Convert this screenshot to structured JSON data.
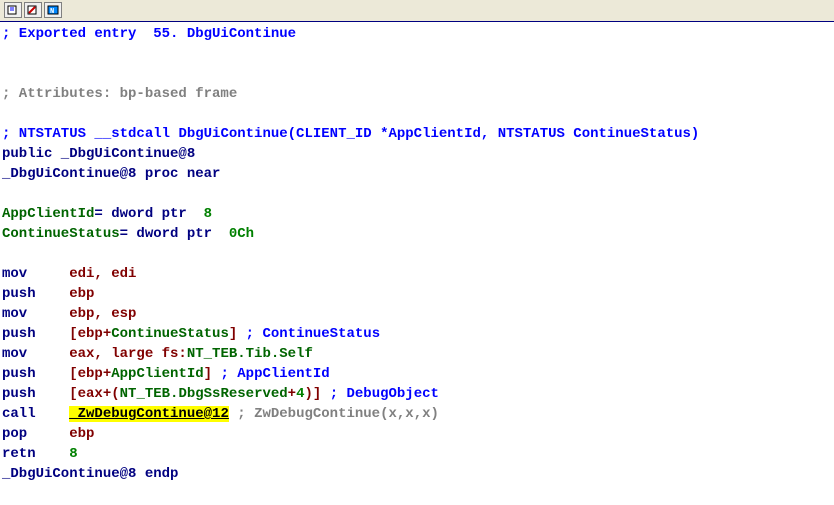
{
  "comment_exported": "; Exported entry  55. DbgUiContinue",
  "comment_attributes": "; Attributes: bp-based frame",
  "comment_signature_prefix": "; NTSTATUS __stdcall ",
  "comment_signature_func": "DbgUiContinue",
  "comment_signature_params": "(CLIENT_ID *AppClientId, NTSTATUS ContinueStatus)",
  "public_decl": "public _DbgUiContinue@8",
  "proc_start_label": "_DbgUiContinue@8",
  "proc_start_suffix": " proc near",
  "local_var1_name": "AppClientId",
  "local_var1_type": "= dword ptr  ",
  "local_var1_offset": "8",
  "local_var2_name": "ContinueStatus",
  "local_var2_type": "= dword ptr  ",
  "local_var2_offset": "0Ch",
  "asm": {
    "l1_op": "mov     ",
    "l1_args": "edi, edi",
    "l2_op": "push    ",
    "l2_args": "ebp",
    "l3_op": "mov     ",
    "l3_args": "ebp, esp",
    "l4_op": "push    ",
    "l4_prefix": "[ebp+",
    "l4_var": "ContinueStatus",
    "l4_suffix": "]",
    "l4_comment": " ; ContinueStatus",
    "l5_op": "mov     ",
    "l5_prefix": "eax, large fs:",
    "l5_struct": "NT_TEB.Tib.Self",
    "l6_op": "push    ",
    "l6_prefix": "[ebp+",
    "l6_var": "AppClientId",
    "l6_suffix": "]",
    "l6_comment": " ; AppClientId",
    "l7_op": "push    ",
    "l7_prefix": "[eax+(",
    "l7_struct": "NT_TEB.DbgSsReserved",
    "l7_mid": "+",
    "l7_num": "4",
    "l7_suffix": ")]",
    "l7_comment": " ; DebugObject",
    "l8_op": "call    ",
    "l8_target": "_ZwDebugContinue@12",
    "l8_comment": " ; ZwDebugContinue(x,x,x)",
    "l9_op": "pop     ",
    "l9_args": "ebp",
    "l10_op": "retn    ",
    "l10_args": "8"
  },
  "proc_end_label": "_DbgUiContinue@8",
  "proc_end_suffix": " endp"
}
